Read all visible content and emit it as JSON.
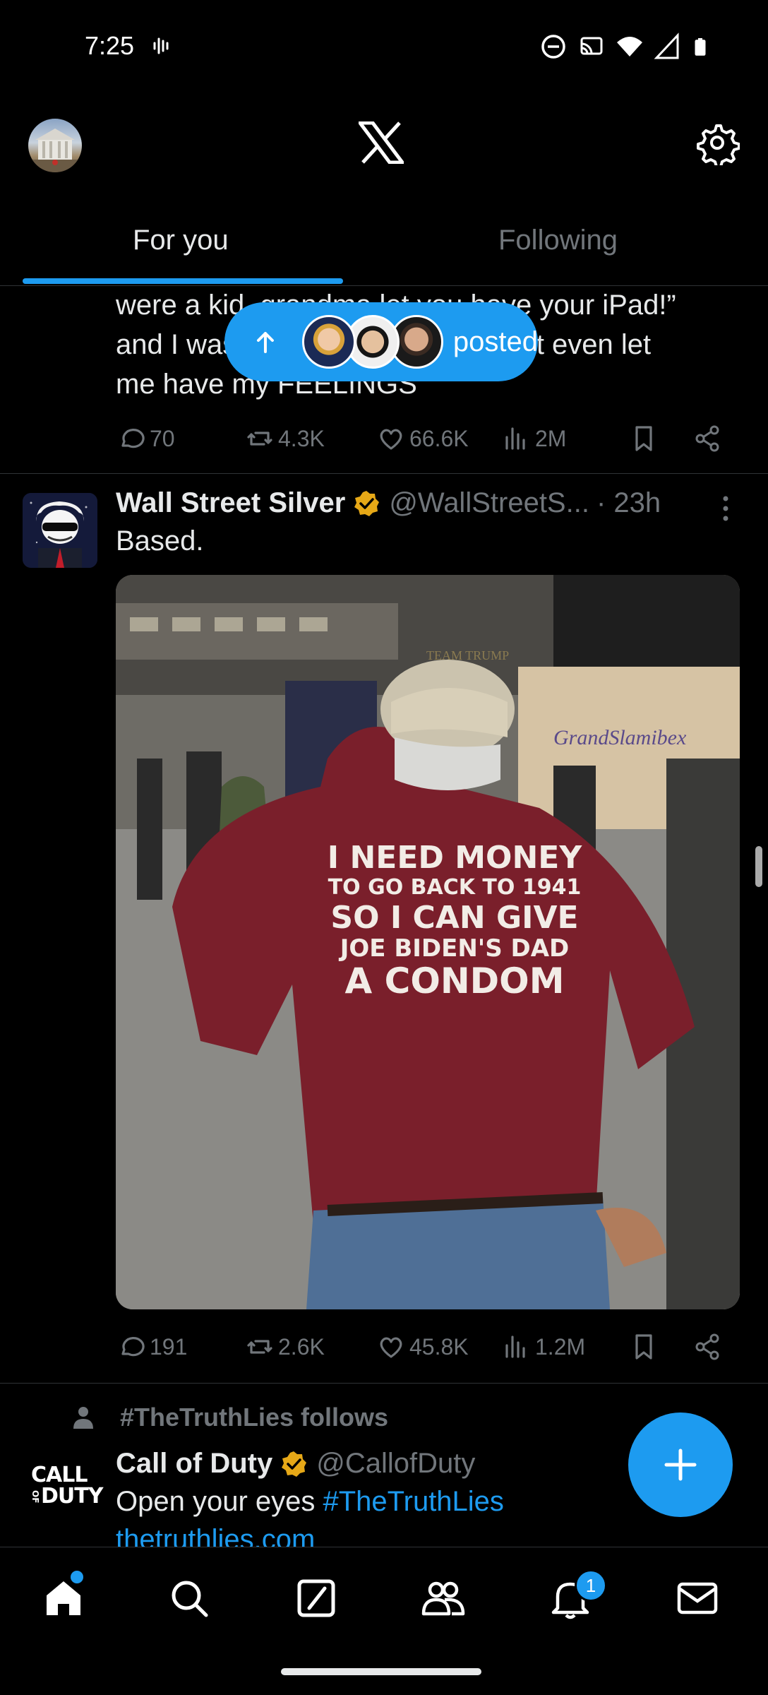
{
  "status_bar": {
    "time": "7:25",
    "icons": [
      "sound-wave-icon",
      "do-not-disturb-icon",
      "cast-icon",
      "wifi-icon",
      "signal-icon",
      "battery-icon"
    ]
  },
  "top_bar": {
    "avatar": "profile-avatar",
    "logo": "x-logo-icon",
    "settings": "gear-icon"
  },
  "tabs": [
    {
      "label": "For you",
      "selected": true
    },
    {
      "label": "Following",
      "selected": false
    }
  ],
  "previous_tweet": {
    "text_lines": [
      "were a kid, grandma let you have your iPad!”",
      "and I was like, “my grandma didn’t even let",
      "me have my FEELINGS"
    ],
    "actions": {
      "replies": "70",
      "reposts": "4.3K",
      "likes": "66.6K",
      "views": "2M"
    }
  },
  "posted_pill": {
    "label": "posted"
  },
  "tweet": {
    "name": "Wall Street Silver",
    "handle": "@WallStreetS...",
    "time": "· 23h",
    "text": "Based.",
    "photo_alt": "Man in red shirt at a crowded convention",
    "shirt_lines": [
      "I NEED MONEY",
      "TO GO BACK TO 1941",
      "SO I CAN GIVE",
      "JOE BIDEN'S DAD",
      "A CONDOM"
    ],
    "hat_text": "TEAM TRUMP",
    "booth_text": "GrandSlamibex",
    "actions": {
      "replies": "191",
      "reposts": "2.6K",
      "likes": "45.8K",
      "views": "1.2M"
    }
  },
  "promo": {
    "follows_line": "#TheTruthLies follows",
    "name": "Call of Duty",
    "handle": "@CallofDuty",
    "text": "Open your eyes ",
    "hashtag": "#TheTruthLies",
    "link": "thetruthlies.com",
    "logo_top": "CALL",
    "logo_of": "OF",
    "logo_bottom": "DUTY"
  },
  "bottom_nav": {
    "items": [
      "home-icon",
      "search-icon",
      "grok-icon",
      "communities-icon",
      "notifications-icon",
      "messages-icon"
    ],
    "notification_count": "1"
  },
  "colors": {
    "accent": "#1d9bf0",
    "background": "#000000",
    "muted": "#71767b",
    "verified": "#e6a817"
  }
}
